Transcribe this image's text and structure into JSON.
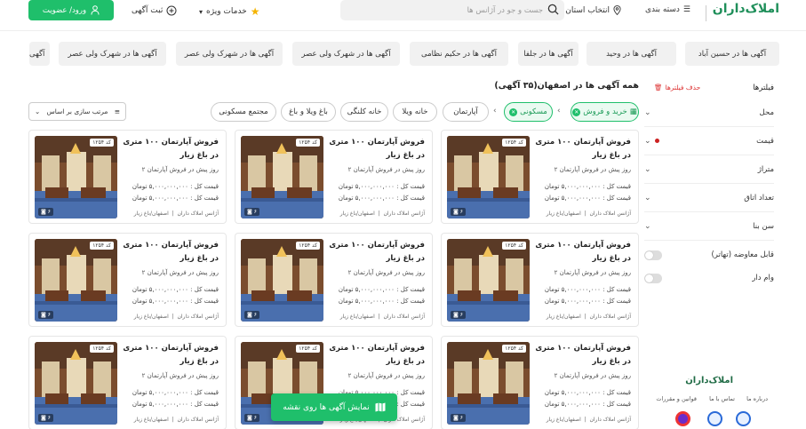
{
  "header": {
    "logo": "املاک‌داران",
    "categories": "دسته بندی",
    "city": "انتخاب استان",
    "search_placeholder": "جست و جو در آژانس ها",
    "special_services": "خدمات ویژه",
    "post_ad": "ثبت آگهی",
    "login": "ورود/ عضویت"
  },
  "neighborhoods": [
    "آگهی ها در حسین آباد",
    "آگهی ها در وحید",
    "آگهی ها در جلفا",
    "آگهی ها در حکیم نظامی",
    "آگهی ها در شهرک ولی عصر",
    "آگهی ها در شهرک ولی عصر",
    "آگهی ها در شهرک ولی عصر",
    "آگهی"
  ],
  "sidebar": {
    "title": "فیلترها",
    "clear": "حذف فیلترها",
    "filters": [
      "محل",
      "قیمت",
      "متراژ",
      "تعداد اتاق",
      "سن بنا"
    ],
    "toggles": [
      "قابل معاوضه (تهاتر)",
      "وام دار"
    ]
  },
  "listing": {
    "heading": "همه آگهی ها در اصفهان(۳۵ آگهی)",
    "sort": "مرتب سازی بر اساس",
    "pills": [
      "خرید و فروش",
      "مسکونی",
      "آپارتمان",
      "خانه ویلا",
      "خانه کلنگی",
      "باغ ویلا و باغ",
      "مجتمع مسکونی"
    ]
  },
  "card": {
    "title": "فروش آپارتمان ۱۰۰ متری در باغ زیار",
    "subtitle": "۲ روز پیش در فروش آپارتمان",
    "price_total": "قیمت کل : ۵,۰۰۰,۰۰۰,۰۰۰ تومان",
    "price_meter": "قیمت کل : ۵,۰۰۰,۰۰۰,۰۰۰ تومان",
    "agency": "آژانس املاک داران",
    "location": "اصفهان/باغ زیار",
    "code": "کد ۱۲۵۴",
    "photos": "۶"
  },
  "map_button": "نمایش آگهی ها روی نقشه",
  "footer": {
    "logo": "املاک‌داران",
    "about": "درباره ما",
    "contact": "تماس با ما",
    "rules": "قوانین و مقررات"
  },
  "colors": {
    "brand_green": "#1fbf6b",
    "danger": "#d33"
  }
}
